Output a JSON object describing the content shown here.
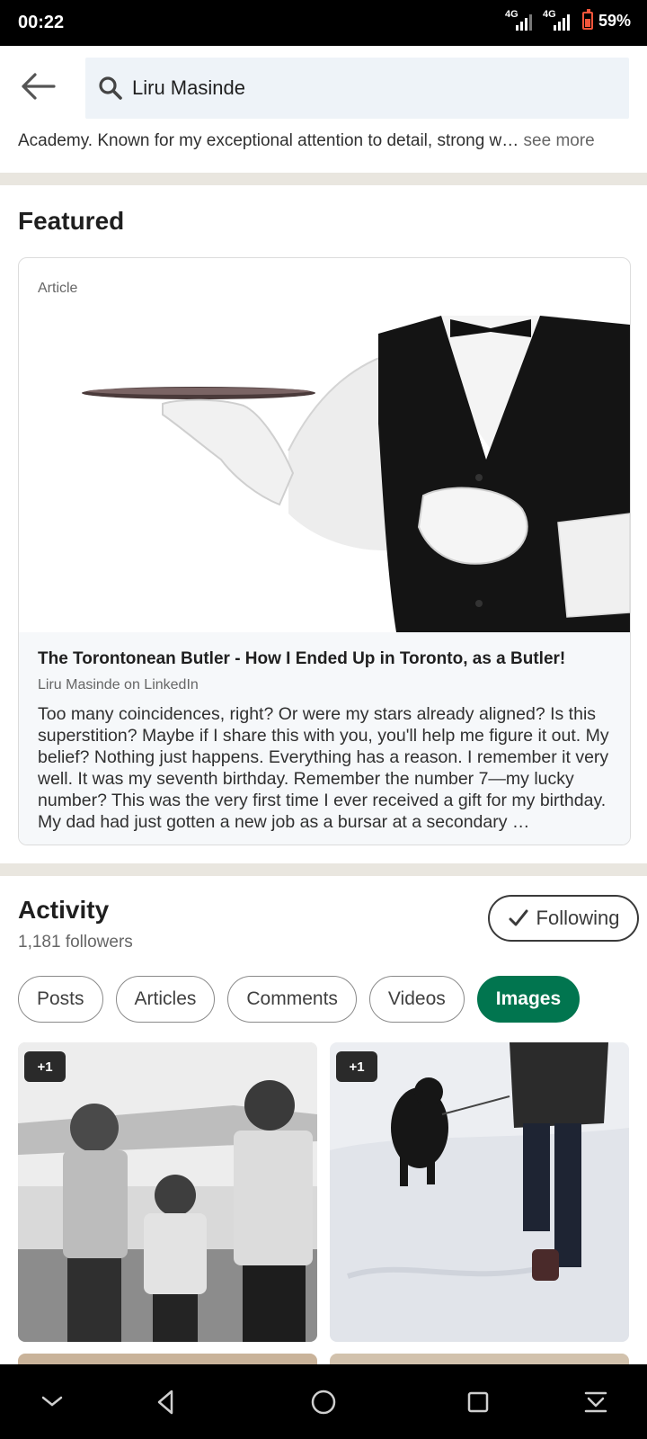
{
  "status_bar": {
    "time": "00:22",
    "net1": "4G",
    "net2": "4G",
    "battery": "59%"
  },
  "search": {
    "query": "Liru Masinde"
  },
  "about": {
    "text_tail": "Academy. Known for my exceptional attention to detail, strong w…",
    "see_more": "see more"
  },
  "featured": {
    "heading": "Featured",
    "item": {
      "type": "Article",
      "title": "The Torontonean Butler - How I Ended Up in Toronto, as a Butler!",
      "source": "Liru Masinde on LinkedIn",
      "excerpt": "Too many coincidences, right? Or were my stars already aligned? Is this superstition? Maybe if I share this with you, you'll help me figure it out. My belief? Nothing just happens. Everything has a reason. I remember it very well. It was my seventh birthday. Remember the number 7—my lucky number? This was the very first time I ever received a gift for my birthday. My dad had just gotten a new job as a bursar at a secondary …"
    }
  },
  "activity": {
    "heading": "Activity",
    "followers": "1,181 followers",
    "following_label": "Following",
    "filters": [
      "Posts",
      "Articles",
      "Comments",
      "Videos",
      "Images"
    ],
    "active_filter": "Images",
    "images": [
      {
        "badge": "+1"
      },
      {
        "badge": "+1"
      }
    ]
  },
  "colors": {
    "accent_green": "#01754f",
    "search_bg": "#eef3f8",
    "divider": "#e9e6df"
  },
  "icons": [
    "back-arrow-icon",
    "search-icon",
    "checkmark-icon",
    "chevron-down-icon",
    "back-triangle-icon",
    "home-circle-icon",
    "recents-square-icon",
    "download-icon"
  ]
}
